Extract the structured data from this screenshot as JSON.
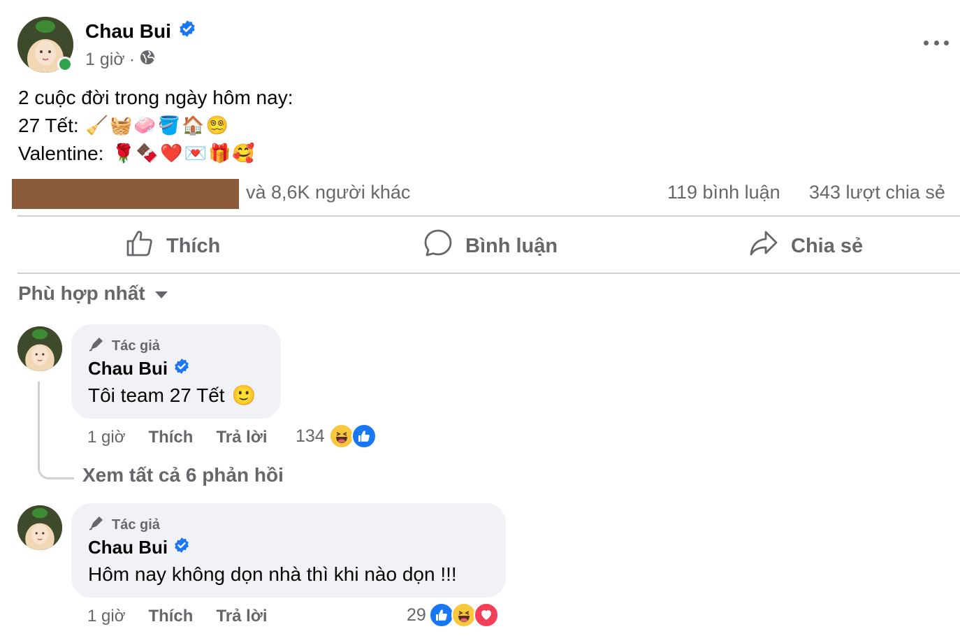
{
  "post": {
    "author": "Chau Bui",
    "time": "1 giờ",
    "separator": "·",
    "body": {
      "line1": "2 cuộc đời trong ngày hôm nay:",
      "line2_label": "27 Tết:",
      "line2_emojis": [
        "🧹",
        "🧺",
        "🧼",
        "🪣",
        "🏠",
        "😵‍💫"
      ],
      "line3_label": "Valentine:",
      "line3_emojis": [
        "🌹",
        "🍫",
        "❤️",
        "💌",
        "🎁",
        "🥰"
      ]
    },
    "stats": {
      "others": "và 8,6K người khác",
      "comments": "119 bình luận",
      "shares": "343 lượt chia sẻ"
    },
    "actions": {
      "like": "Thích",
      "comment": "Bình luận",
      "share": "Chia sẻ"
    }
  },
  "comments_section": {
    "sort_label": "Phù hợp nhất",
    "view_replies": "Xem tất cả 6 phản hồi",
    "comments": [
      {
        "badge": "Tác giả",
        "author": "Chau Bui",
        "text": "Tôi team 27 Tết",
        "text_emoji": "🙂",
        "time": "1 giờ",
        "like_label": "Thích",
        "reply_label": "Trả lời",
        "reaction_count": "134"
      },
      {
        "badge": "Tác giả",
        "author": "Chau Bui",
        "text": "Hôm nay không dọn nhà thì khi nào dọn !!!",
        "time": "1 giờ",
        "like_label": "Thích",
        "reply_label": "Trả lời",
        "reaction_count": "29"
      }
    ]
  },
  "colors": {
    "verified": "#1877f2",
    "secondary_text": "#65676b",
    "bubble": "#f0f2f5",
    "online": "#31a24c",
    "redacted": "#8b5a3a"
  }
}
